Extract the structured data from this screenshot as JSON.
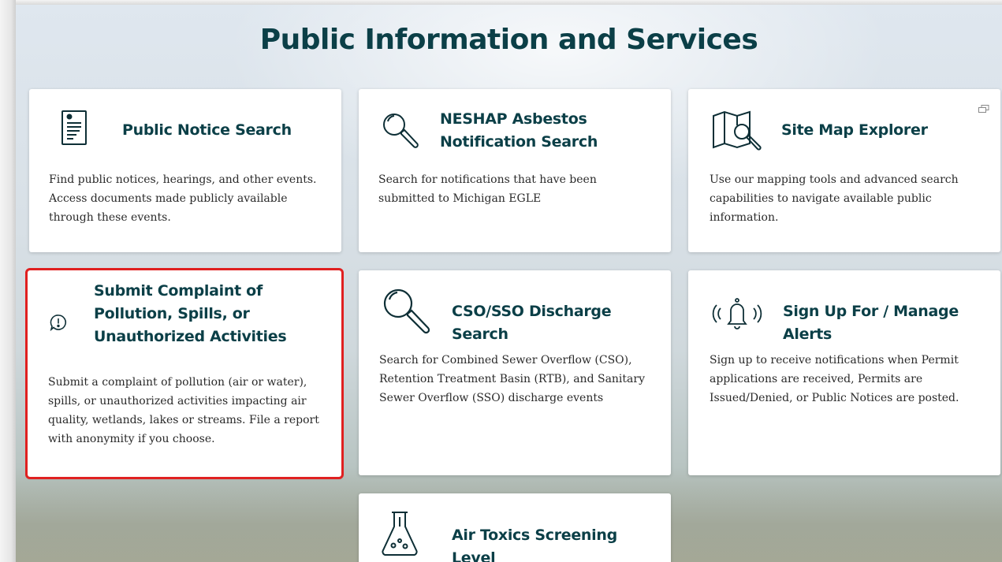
{
  "page": {
    "title": "Public Information and Services"
  },
  "cards": [
    {
      "title": "Public Notice Search",
      "description": "Find public notices, hearings, and other events. Access documents made publicly available through these events.",
      "icon": "document-icon"
    },
    {
      "title": "NESHAP Asbestos Notification Search",
      "description": "Search for notifications that have been submitted to Michigan EGLE",
      "icon": "magnifier-icon"
    },
    {
      "title": "Site Map Explorer",
      "description": "Use our mapping tools and advanced search capabilities to navigate available public information.",
      "icon": "map-search-icon",
      "badge_icon": "external-window-icon"
    },
    {
      "title": "Submit Complaint of Pollution, Spills, or Unauthorized Activities",
      "description": "Submit a complaint of pollution (air or water), spills, or unauthorized activities impacting air quality, wetlands, lakes or streams. File a report with anonymity if you choose.",
      "icon": "exclamation-bubble-icon",
      "highlight_color": "#e02020"
    },
    {
      "title": "CSO/SSO Discharge Search",
      "description": "Search for Combined Sewer Overflow (CSO), Retention Treatment Basin (RTB), and Sanitary Sewer Overflow (SSO) discharge events",
      "icon": "magnifier-icon"
    },
    {
      "title": "Sign Up For / Manage Alerts",
      "description": "Sign up to receive notifications when Permit applications are received, Permits are Issued/Denied, or Public Notices are posted.",
      "icon": "bell-icon"
    },
    {
      "title": "Air Toxics Screening Level",
      "description": "",
      "icon": "flask-icon"
    }
  ],
  "colors": {
    "title": "#0b3f47",
    "highlight": "#e02020",
    "card_bg": "#ffffff"
  }
}
